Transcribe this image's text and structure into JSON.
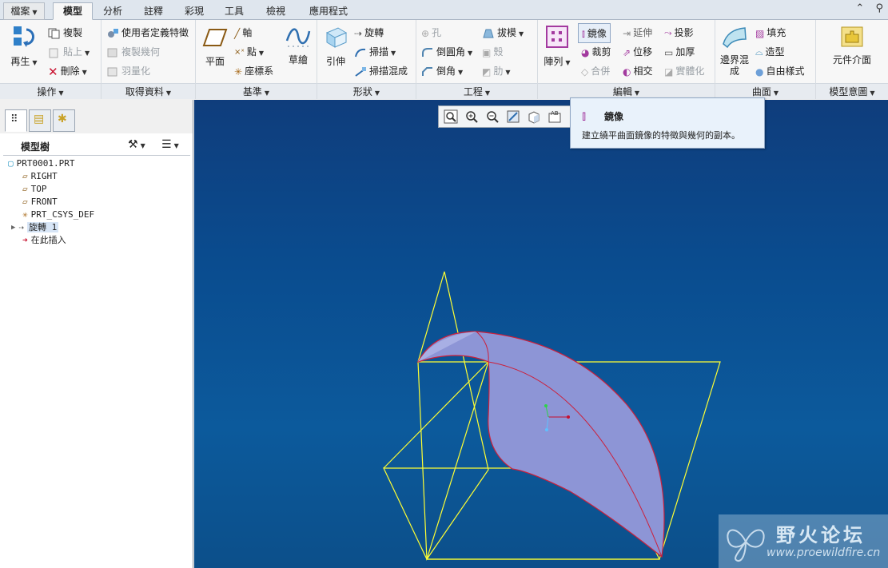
{
  "tabs": [
    {
      "label": "檔案",
      "active": false,
      "file": true
    },
    {
      "label": "模型",
      "active": true
    },
    {
      "label": "分析",
      "active": false
    },
    {
      "label": "註釋",
      "active": false
    },
    {
      "label": "彩現",
      "active": false
    },
    {
      "label": "工具",
      "active": false
    },
    {
      "label": "檢視",
      "active": false
    },
    {
      "label": "應用程式",
      "active": false
    }
  ],
  "ribbon": {
    "operations": {
      "label": "操作",
      "regenerate": "再生",
      "copy": "複製",
      "paste": "貼上",
      "delete": "刪除"
    },
    "get_data": {
      "label": "取得資料",
      "udf": "使用者定義特徵",
      "copy_geometry": "複製幾何",
      "shrinkwrap": "羽量化"
    },
    "datum": {
      "label": "基準",
      "plane": "平面",
      "axis": "軸",
      "point": "點",
      "csys": "座標系",
      "sketch": "草繪"
    },
    "shapes": {
      "label": "形狀",
      "extrude": "引伸",
      "revolve": "旋轉",
      "sweep": "掃描",
      "swept_blend": "掃描混成"
    },
    "engineering": {
      "label": "工程",
      "hole": "孔",
      "draft": "拔模",
      "round": "倒圓角",
      "shell": "殼",
      "chamfer": "倒角",
      "rib": "肋"
    },
    "editing": {
      "label": "編輯",
      "pattern": "陣列",
      "mirror": "鏡像",
      "extend": "延伸",
      "project": "投影",
      "trim": "裁剪",
      "offset": "位移",
      "thicken": "加厚",
      "merge": "合併",
      "intersect": "相交",
      "solidify": "實體化"
    },
    "surfaces": {
      "label": "曲面",
      "boundary_blend": "邊界混成",
      "fill": "填充",
      "style": "造型",
      "freestyle": "自由樣式"
    },
    "model_intent": {
      "label": "模型意圖",
      "component_interface": "元件介面"
    }
  },
  "model_tree": {
    "title": "模型樹",
    "items": [
      {
        "label": "PRT0001.PRT",
        "indent": 0
      },
      {
        "label": "RIGHT",
        "indent": 1
      },
      {
        "label": "TOP",
        "indent": 1
      },
      {
        "label": "FRONT",
        "indent": 1
      },
      {
        "label": "PRT_CSYS_DEF",
        "indent": 1
      },
      {
        "label": "旋轉 1",
        "indent": 1,
        "selected": true
      },
      {
        "label": "在此插入",
        "indent": 1
      }
    ]
  },
  "tooltip": {
    "title": "鏡像",
    "body": "建立繞平曲面鏡像的特徵與幾何的副本。"
  },
  "watermark": {
    "title": "野火论坛",
    "url": "www.proewildfire.cn"
  },
  "colors": {
    "viewport_top": "#0f3d7c",
    "surface": "#8d95d6",
    "datum_plane": "#ffff33",
    "edge": "#cc1f3a"
  }
}
